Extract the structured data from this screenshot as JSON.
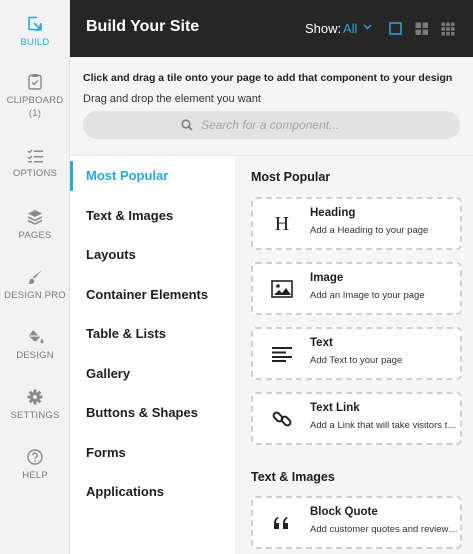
{
  "rail": {
    "items": [
      {
        "label": "BUILD",
        "icon": "build-icon",
        "active": true
      },
      {
        "label": "CLIPBOARD",
        "sublabel": "(1)",
        "icon": "clipboard-icon"
      },
      {
        "label": "OPTIONS",
        "icon": "options-icon"
      },
      {
        "label": "PAGES",
        "icon": "pages-icon"
      },
      {
        "label": "DESIGN PRO",
        "icon": "design-pro-icon"
      },
      {
        "label": "DESIGN",
        "icon": "design-icon"
      },
      {
        "label": "SETTINGS",
        "icon": "settings-icon"
      },
      {
        "label": "HELP",
        "icon": "help-icon"
      }
    ]
  },
  "header": {
    "title": "Build Your Site",
    "show_label": "Show:",
    "show_value": "All"
  },
  "intro": {
    "main": "Click and drag a tile onto your page to add that component to your design",
    "sub": "Drag and drop the element you want"
  },
  "search": {
    "placeholder": "Search for a component..."
  },
  "categories": [
    {
      "label": "Most Popular",
      "active": true
    },
    {
      "label": "Text & Images"
    },
    {
      "label": "Layouts"
    },
    {
      "label": "Container Elements"
    },
    {
      "label": "Table & Lists"
    },
    {
      "label": "Gallery"
    },
    {
      "label": "Buttons & Shapes"
    },
    {
      "label": "Forms"
    },
    {
      "label": "Applications"
    }
  ],
  "sections": [
    {
      "title": "Most Popular",
      "tiles": [
        {
          "title": "Heading",
          "desc": "Add a Heading to your page",
          "icon": "heading-icon",
          "glyph": "H"
        },
        {
          "title": "Image",
          "desc": "Add an Image to your page",
          "icon": "image-icon"
        },
        {
          "title": "Text",
          "desc": "Add Text to your page",
          "icon": "text-icon"
        },
        {
          "title": "Text Link",
          "desc": "Add a Link that will take visitors to another page",
          "icon": "link-icon"
        }
      ]
    },
    {
      "title": "Text & Images",
      "tiles": [
        {
          "title": "Block Quote",
          "desc": "Add customer quotes and reviews to your page",
          "icon": "quote-icon"
        }
      ]
    }
  ],
  "colors": {
    "accent": "#2aa7dc",
    "header_bg": "#262626",
    "rail_bg": "#f2f2f2",
    "panel_bg": "#f5f5f5"
  }
}
